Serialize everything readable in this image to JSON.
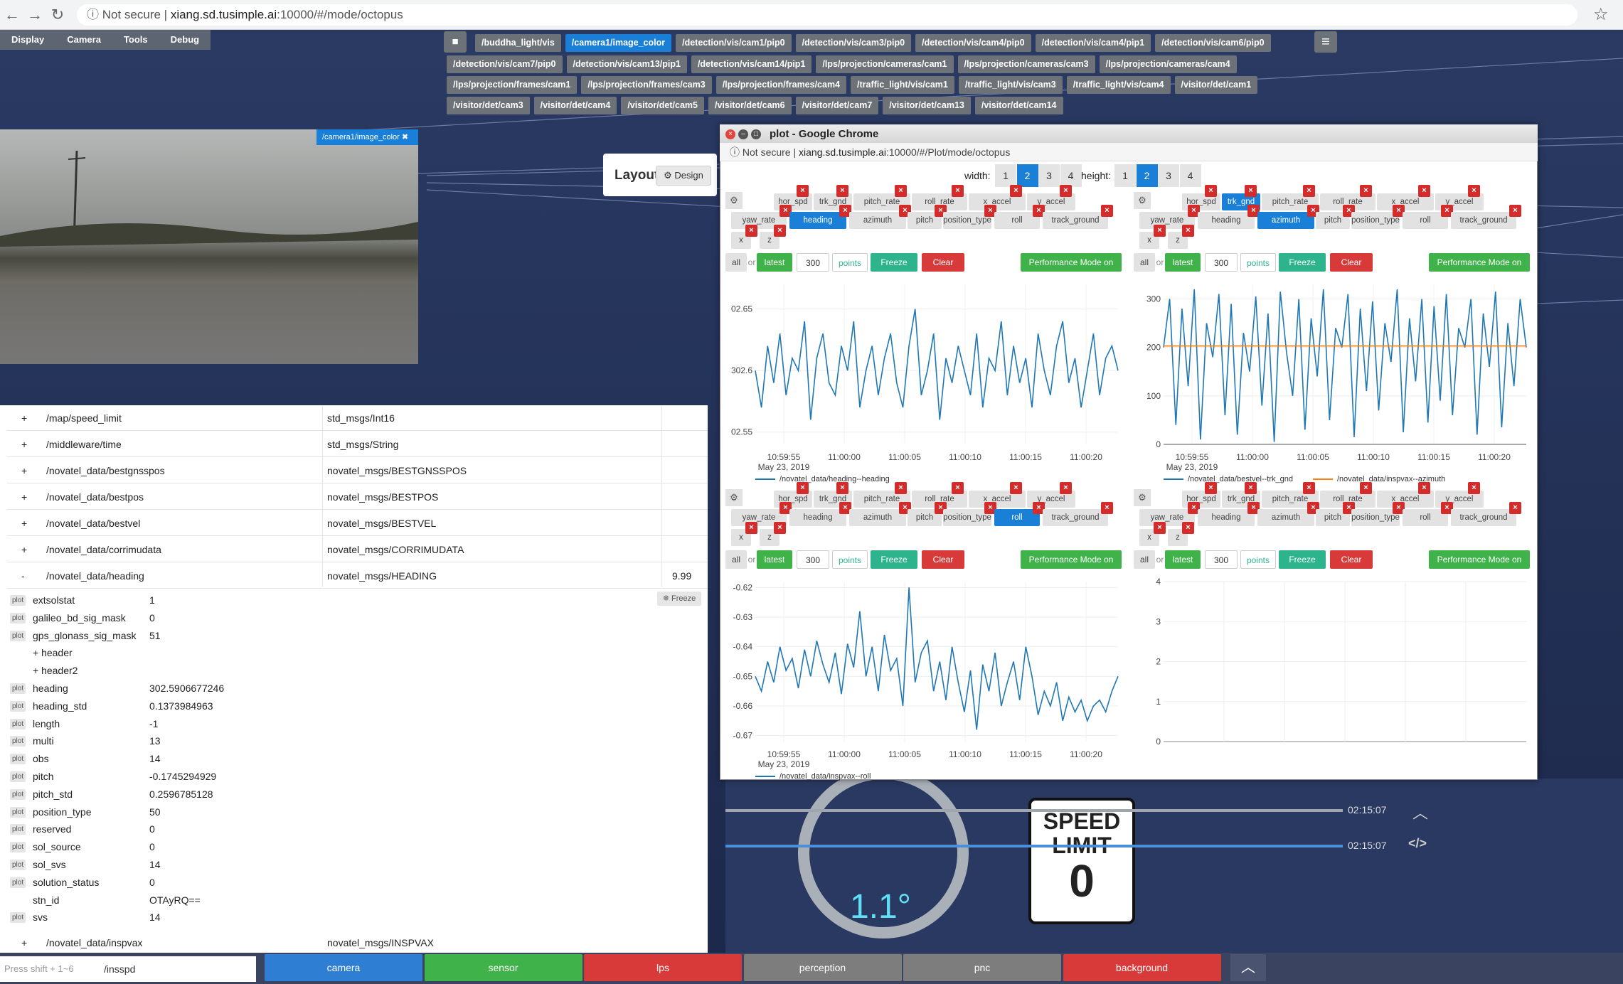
{
  "browser": {
    "back": "←",
    "forward": "→",
    "reload": "↻",
    "security": "Not secure",
    "host": "xiang.sd.tusimple.ai",
    "path": ":10000/#/mode/octopus",
    "star": "☆"
  },
  "menu": [
    "Display",
    "Camera",
    "Tools",
    "Debug"
  ],
  "topic_buttons": [
    {
      "label": "/buddha_light/vis",
      "active": false
    },
    {
      "label": "/camera1/image_color",
      "active": true
    },
    {
      "label": "/detection/vis/cam1/pip0",
      "active": false
    },
    {
      "label": "/detection/vis/cam3/pip0",
      "active": false
    },
    {
      "label": "/detection/vis/cam4/pip0",
      "active": false
    },
    {
      "label": "/detection/vis/cam4/pip1",
      "active": false
    },
    {
      "label": "/detection/vis/cam6/pip0",
      "active": false
    },
    {
      "label": "/detection/vis/cam7/pip0",
      "active": false
    },
    {
      "label": "/detection/vis/cam13/pip1",
      "active": false
    },
    {
      "label": "/detection/vis/cam14/pip1",
      "active": false
    },
    {
      "label": "/lps/projection/cameras/cam1",
      "active": false
    },
    {
      "label": "/lps/projection/cameras/cam3",
      "active": false
    },
    {
      "label": "/lps/projection/cameras/cam4",
      "active": false
    },
    {
      "label": "/lps/projection/frames/cam1",
      "active": false
    },
    {
      "label": "/lps/projection/frames/cam3",
      "active": false
    },
    {
      "label": "/lps/projection/frames/cam4",
      "active": false
    },
    {
      "label": "/traffic_light/vis/cam1",
      "active": false
    },
    {
      "label": "/traffic_light/vis/cam3",
      "active": false
    },
    {
      "label": "/traffic_light/vis/cam4",
      "active": false
    },
    {
      "label": "/visitor/det/cam1",
      "active": false
    },
    {
      "label": "/visitor/det/cam3",
      "active": false
    },
    {
      "label": "/visitor/det/cam4",
      "active": false
    },
    {
      "label": "/visitor/det/cam5",
      "active": false
    },
    {
      "label": "/visitor/det/cam6",
      "active": false
    },
    {
      "label": "/visitor/det/cam7",
      "active": false
    },
    {
      "label": "/visitor/det/cam13",
      "active": false
    },
    {
      "label": "/visitor/det/cam14",
      "active": false
    }
  ],
  "camera_tag": "/camera1/image_color ✖",
  "layout": {
    "title": "Layout",
    "design": "⚙ Design"
  },
  "topics": [
    {
      "pm": "+",
      "name": "/map/speed_limit",
      "type": "std_msgs/Int16",
      "hz": ""
    },
    {
      "pm": "+",
      "name": "/middleware/time",
      "type": "std_msgs/String",
      "hz": ""
    },
    {
      "pm": "+",
      "name": "/novatel_data/bestgnsspos",
      "type": "novatel_msgs/BESTGNSSPOS",
      "hz": ""
    },
    {
      "pm": "+",
      "name": "/novatel_data/bestpos",
      "type": "novatel_msgs/BESTPOS",
      "hz": ""
    },
    {
      "pm": "+",
      "name": "/novatel_data/bestvel",
      "type": "novatel_msgs/BESTVEL",
      "hz": ""
    },
    {
      "pm": "+",
      "name": "/novatel_data/corrimudata",
      "type": "novatel_msgs/CORRIMUDATA",
      "hz": ""
    },
    {
      "pm": "-",
      "name": "/novatel_data/heading",
      "type": "novatel_msgs/HEADING",
      "hz": "9.99"
    }
  ],
  "freeze_small": "❄ Freeze",
  "fields": [
    {
      "plot": "plot",
      "key": "extsolstat",
      "value": "1"
    },
    {
      "plot": "plot",
      "key": "galileo_bd_sig_mask",
      "value": "0"
    },
    {
      "plot": "plot",
      "key": "gps_glonass_sig_mask",
      "value": "51"
    },
    {
      "plot": "",
      "key": "+ header",
      "value": ""
    },
    {
      "plot": "",
      "key": "+ header2",
      "value": ""
    },
    {
      "plot": "plot",
      "key": "heading",
      "value": "302.5906677246"
    },
    {
      "plot": "plot",
      "key": "heading_std",
      "value": "0.1373984963"
    },
    {
      "plot": "plot",
      "key": "length",
      "value": "-1"
    },
    {
      "plot": "plot",
      "key": "multi",
      "value": "13"
    },
    {
      "plot": "plot",
      "key": "obs",
      "value": "14"
    },
    {
      "plot": "plot",
      "key": "pitch",
      "value": "-0.1745294929"
    },
    {
      "plot": "plot",
      "key": "pitch_std",
      "value": "0.2596785128"
    },
    {
      "plot": "plot",
      "key": "position_type",
      "value": "50"
    },
    {
      "plot": "plot",
      "key": "reserved",
      "value": "0"
    },
    {
      "plot": "plot",
      "key": "sol_source",
      "value": "0"
    },
    {
      "plot": "plot",
      "key": "sol_svs",
      "value": "14"
    },
    {
      "plot": "plot",
      "key": "solution_status",
      "value": "0"
    },
    {
      "plot": "",
      "key": "stn_id",
      "value": "OTAyRQ=="
    },
    {
      "plot": "plot",
      "key": "svs",
      "value": "14"
    }
  ],
  "inspvax_row": {
    "pm": "+",
    "name": "/novatel_data/inspvax",
    "type": "novatel_msgs/INSPVAX"
  },
  "bottom": {
    "hint": "Press shift + 1~6",
    "search_value": "/insspd",
    "buttons": [
      {
        "label": "camera",
        "color": "#2e7fd3"
      },
      {
        "label": "sensor",
        "color": "#3fb34a"
      },
      {
        "label": "lps",
        "color": "#d83a3a"
      },
      {
        "label": "perception",
        "color": "#7d7d7d"
      },
      {
        "label": "pnc",
        "color": "#7d7d7d"
      },
      {
        "label": "background",
        "color": "#d83a3a"
      }
    ],
    "up": "︿"
  },
  "dashboard": {
    "angle": "1.1°",
    "speed_limit_line1": "SPEED",
    "speed_limit_line2": "LIMIT",
    "speed_limit_value": "0",
    "time1": "02:15:07",
    "time2": "02:15:07",
    "up_icon": "︿",
    "code_icon": "</>"
  },
  "plot_window": {
    "title": "plot - Google Chrome",
    "security": "Not secure",
    "url_host": "xiang.sd.tusimple.ai",
    "url_path": ":10000/#/Plot/mode/octopus",
    "width_label": "width:",
    "height_label": "height:",
    "width_options": [
      "1",
      "2",
      "3",
      "4"
    ],
    "width_selected": "2",
    "height_options": [
      "1",
      "2",
      "3",
      "4"
    ],
    "height_selected": "2",
    "field_row1": [
      "hor_spd",
      "trk_gnd",
      "pitch_rate",
      "roll_rate",
      "x_accel",
      "y_accel"
    ],
    "field_row2": [
      "yaw_rate",
      "heading",
      "azimuth",
      "pitch",
      "position_type",
      "roll",
      "track_ground"
    ],
    "field_row3": [
      "x",
      "z"
    ],
    "controls": {
      "all": "all",
      "or": "or",
      "latest": "latest",
      "count": "300",
      "points": "points",
      "freeze": "Freeze",
      "clear": "Clear",
      "perf": "Performance Mode on"
    },
    "panels": [
      {
        "active_fields": [
          "heading"
        ],
        "legend": [
          {
            "name": "/novatel_data/heading--heading",
            "color": "#1f77b4"
          }
        ]
      },
      {
        "active_fields": [
          "trk_gnd",
          "azimuth"
        ],
        "legend": [
          {
            "name": "/novatel_data/bestvel--trk_gnd",
            "color": "#1f77b4"
          },
          {
            "name": "/novatel_data/inspvax--azimuth",
            "color": "#ff7f0e"
          }
        ]
      },
      {
        "active_fields": [
          "roll"
        ],
        "legend": [
          {
            "name": "/novatel_data/inspvax--roll",
            "color": "#1f77b4"
          }
        ]
      },
      {
        "active_fields": [],
        "legend": []
      }
    ]
  },
  "chart_data": [
    {
      "type": "line",
      "x_ticks": [
        "10:59:55",
        "11:00:00",
        "11:00:05",
        "11:00:10",
        "11:00:15",
        "11:00:20"
      ],
      "x_subtitle": "May 23, 2019",
      "y_ticks": [
        "02.55",
        "302.6",
        "02.65"
      ],
      "ylim": [
        302.54,
        302.67
      ],
      "series": [
        {
          "name": "/novatel_data/heading--heading",
          "color": "#1f77b4",
          "values": [
            302.6,
            302.57,
            302.62,
            302.59,
            302.63,
            302.58,
            302.61,
            302.6,
            302.64,
            302.56,
            302.61,
            302.63,
            302.59,
            302.58,
            302.62,
            302.6,
            302.64,
            302.57,
            302.6,
            302.62,
            302.58,
            302.61,
            302.63,
            302.59,
            302.57,
            302.62,
            302.65,
            302.58,
            302.6,
            302.63,
            302.56,
            302.61,
            302.59,
            302.62,
            302.6,
            302.58,
            302.63,
            302.57,
            302.61,
            302.6,
            302.64,
            302.58,
            302.62,
            302.59,
            302.61,
            302.57,
            302.63,
            302.6,
            302.58,
            302.62,
            302.64,
            302.59,
            302.61,
            302.57,
            302.6,
            302.63,
            302.58,
            302.61,
            302.62,
            302.6
          ]
        }
      ]
    },
    {
      "type": "line",
      "x_ticks": [
        "10:59:55",
        "11:00:00",
        "11:00:05",
        "11:00:10",
        "11:00:15",
        "11:00:20"
      ],
      "x_subtitle": "May 23, 2019",
      "y_ticks": [
        "0",
        "100",
        "200",
        "300"
      ],
      "ylim": [
        0,
        330
      ],
      "series": [
        {
          "name": "/novatel_data/bestvel--trk_gnd",
          "color": "#1f77b4",
          "values": [
            200,
            300,
            40,
            280,
            120,
            320,
            10,
            250,
            180,
            310,
            60,
            290,
            20,
            230,
            150,
            305,
            80,
            270,
            5,
            315,
            190,
            100,
            300,
            30,
            260,
            140,
            320,
            50,
            240,
            200,
            310,
            15,
            280,
            110,
            295,
            70,
            250,
            170,
            320,
            25,
            260,
            130,
            300,
            45,
            285,
            90,
            310,
            60,
            240,
            200,
            300,
            20,
            270,
            160,
            315,
            35,
            250,
            120,
            300,
            200
          ]
        },
        {
          "name": "/novatel_data/inspvax--azimuth",
          "color": "#ff7f0e",
          "values": [
            203,
            203,
            203,
            203,
            203,
            203,
            203,
            203,
            203,
            203,
            203,
            203,
            203,
            203,
            203,
            203,
            203,
            203,
            203,
            203,
            203,
            203,
            203,
            203,
            203,
            203,
            203,
            203,
            203,
            203,
            203,
            203,
            203,
            203,
            203,
            203,
            203,
            203,
            203,
            203,
            203,
            203,
            203,
            203,
            203,
            203,
            203,
            203,
            203,
            203,
            203,
            203,
            203,
            203,
            203,
            203,
            203,
            203,
            203,
            203
          ]
        }
      ]
    },
    {
      "type": "line",
      "x_ticks": [
        "10:59:55",
        "11:00:00",
        "11:00:05",
        "11:00:10",
        "11:00:15",
        "11:00:20"
      ],
      "x_subtitle": "May 23, 2019",
      "y_ticks": [
        "-0.67",
        "-0.66",
        "-0.65",
        "-0.64",
        "-0.63",
        "-0.62"
      ],
      "ylim": [
        -0.672,
        -0.618
      ],
      "series": [
        {
          "name": "/novatel_data/inspvax--roll",
          "color": "#1f77b4",
          "values": [
            -0.65,
            -0.655,
            -0.645,
            -0.652,
            -0.64,
            -0.648,
            -0.644,
            -0.654,
            -0.641,
            -0.65,
            -0.638,
            -0.646,
            -0.652,
            -0.642,
            -0.656,
            -0.639,
            -0.647,
            -0.628,
            -0.65,
            -0.64,
            -0.655,
            -0.636,
            -0.648,
            -0.644,
            -0.66,
            -0.62,
            -0.652,
            -0.642,
            -0.638,
            -0.655,
            -0.645,
            -0.658,
            -0.64,
            -0.652,
            -0.662,
            -0.648,
            -0.668,
            -0.646,
            -0.655,
            -0.642,
            -0.66,
            -0.652,
            -0.645,
            -0.658,
            -0.64,
            -0.65,
            -0.663,
            -0.655,
            -0.66,
            -0.652,
            -0.665,
            -0.657,
            -0.662,
            -0.658,
            -0.665,
            -0.66,
            -0.658,
            -0.662,
            -0.655,
            -0.65
          ]
        }
      ]
    },
    {
      "type": "line",
      "x_ticks": [],
      "y_ticks": [
        "0",
        "1",
        "2",
        "3",
        "4"
      ],
      "ylim": [
        0,
        4
      ],
      "series": []
    }
  ]
}
